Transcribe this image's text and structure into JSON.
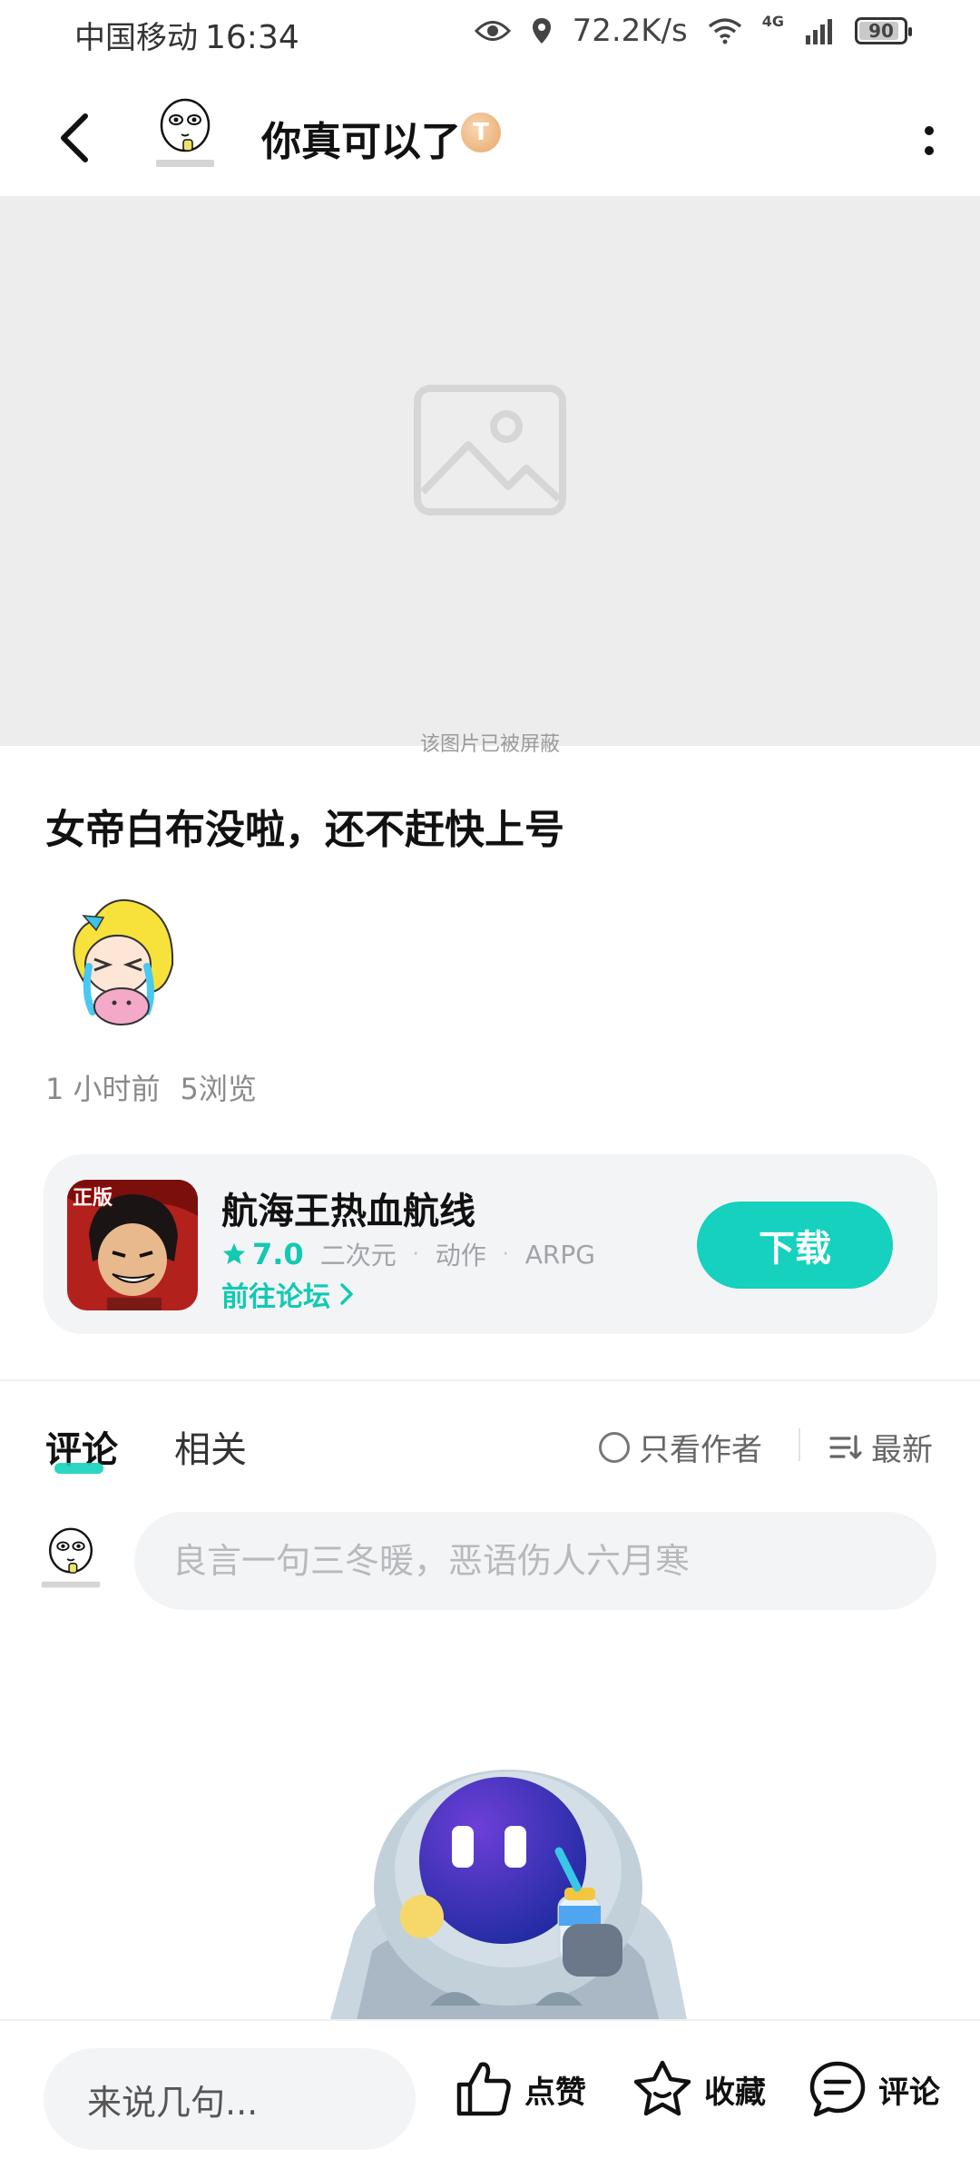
{
  "status_bar": {
    "carrier": "中国移动",
    "time": "16:34",
    "net_speed": "72.2K/s",
    "network": "4G",
    "battery": "90"
  },
  "header": {
    "author_name": "你真可以了",
    "badge_text": "T"
  },
  "media": {
    "blocked_caption": "该图片已被屏蔽"
  },
  "post": {
    "title": "女帝白布没啦，还不赶快上号",
    "time_ago": "1 小时前",
    "views": "5浏览"
  },
  "game_card": {
    "name": "航海王热血航线",
    "rating": "7.0",
    "tags": [
      "二次元",
      "动作",
      "ARPG"
    ],
    "forum_link": "前往论坛",
    "download_label": "下载",
    "icon_badge": "正版"
  },
  "comments": {
    "tabs": [
      "评论",
      "相关"
    ],
    "only_author": "只看作者",
    "sort": "最新",
    "input_placeholder": "良言一句三冬暖，恶语伤人六月寒"
  },
  "bottom_bar": {
    "say_placeholder": "来说几句...",
    "like": "点赞",
    "favorite": "收藏",
    "comment": "评论"
  },
  "colors": {
    "accent": "#15d1bd",
    "card_bg": "#f3f4f6",
    "media_bg": "#ededed"
  }
}
